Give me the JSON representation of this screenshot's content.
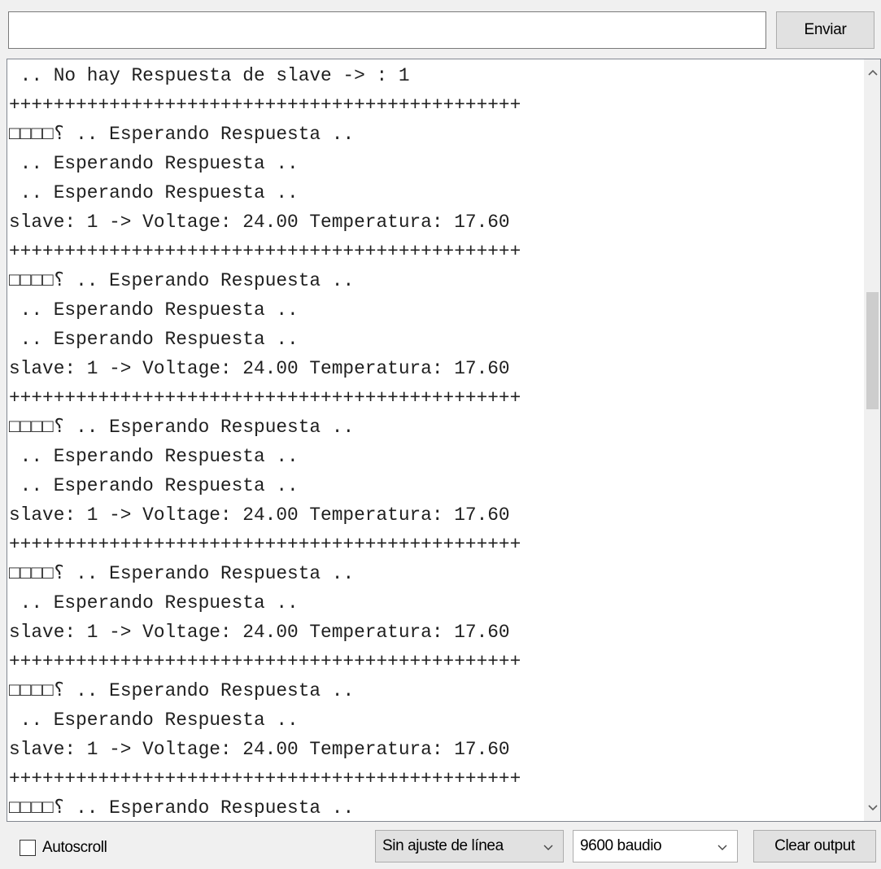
{
  "input": {
    "value": "",
    "placeholder": ""
  },
  "send_label": "Enviar",
  "output_lines": [
    " .. No hay Respuesta de slave -> : 1",
    "++++++++++++++++++++++++++++++++++++++++++++++",
    "□□□□⸮ .. Esperando Respuesta ..",
    " .. Esperando Respuesta ..",
    " .. Esperando Respuesta ..",
    "slave: 1 -> Voltage: 24.00 Temperatura: 17.60",
    "++++++++++++++++++++++++++++++++++++++++++++++",
    "□□□□⸮ .. Esperando Respuesta ..",
    " .. Esperando Respuesta ..",
    " .. Esperando Respuesta ..",
    "slave: 1 -> Voltage: 24.00 Temperatura: 17.60",
    "++++++++++++++++++++++++++++++++++++++++++++++",
    "□□□□⸮ .. Esperando Respuesta ..",
    " .. Esperando Respuesta ..",
    " .. Esperando Respuesta ..",
    "slave: 1 -> Voltage: 24.00 Temperatura: 17.60",
    "++++++++++++++++++++++++++++++++++++++++++++++",
    "□□□□⸮ .. Esperando Respuesta ..",
    " .. Esperando Respuesta ..",
    "slave: 1 -> Voltage: 24.00 Temperatura: 17.60",
    "++++++++++++++++++++++++++++++++++++++++++++++",
    "□□□□⸮ .. Esperando Respuesta ..",
    " .. Esperando Respuesta ..",
    "slave: 1 -> Voltage: 24.00 Temperatura: 17.60",
    "++++++++++++++++++++++++++++++++++++++++++++++",
    "□□□□⸮ .. Esperando Respuesta .."
  ],
  "autoscroll": {
    "label": "Autoscroll",
    "checked": false
  },
  "line_ending": {
    "selected": "Sin ajuste de línea"
  },
  "baud_rate": {
    "selected": "9600 baudio"
  },
  "clear_label": "Clear output",
  "scroll_position": 0.35,
  "icons": {
    "scroll_up": "chevron-up-icon",
    "scroll_down": "chevron-down-icon",
    "select_arrow": "chevron-down-icon"
  }
}
